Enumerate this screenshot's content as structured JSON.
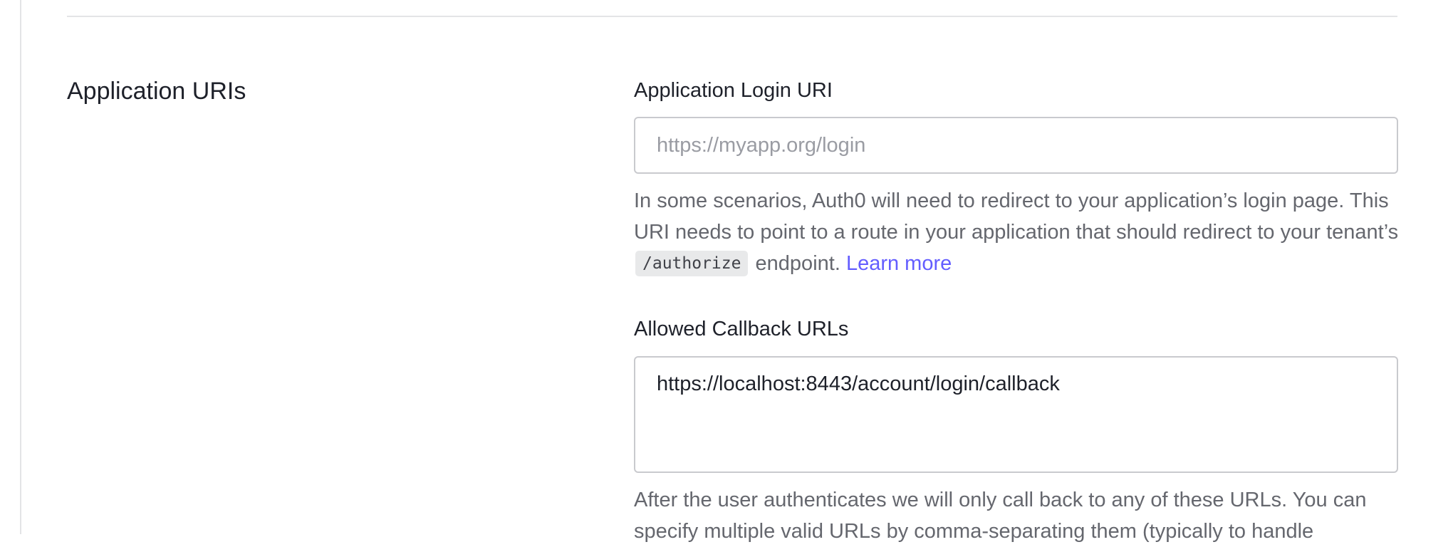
{
  "section": {
    "title": "Application URIs"
  },
  "login_uri": {
    "label": "Application Login URI",
    "value": "",
    "placeholder": "https://myapp.org/login",
    "help_before_code": "In some scenarios, Auth0 will need to redirect to your application’s login page. This URI needs to point to a route in your application that should redirect to your tenant’s",
    "help_code": "/authorize",
    "help_after_code": "endpoint.",
    "learn_more": "Learn more"
  },
  "callback_urls": {
    "label": "Allowed Callback URLs",
    "value": "https://localhost:8443/account/login/callback",
    "help": "After the user authenticates we will only call back to any of these URLs. You can specify multiple valid URLs by comma-separating them (typically to handle"
  },
  "colors": {
    "link": "#635dff",
    "text": "#1e212a",
    "muted": "#65676e",
    "border": "#c9cace"
  }
}
